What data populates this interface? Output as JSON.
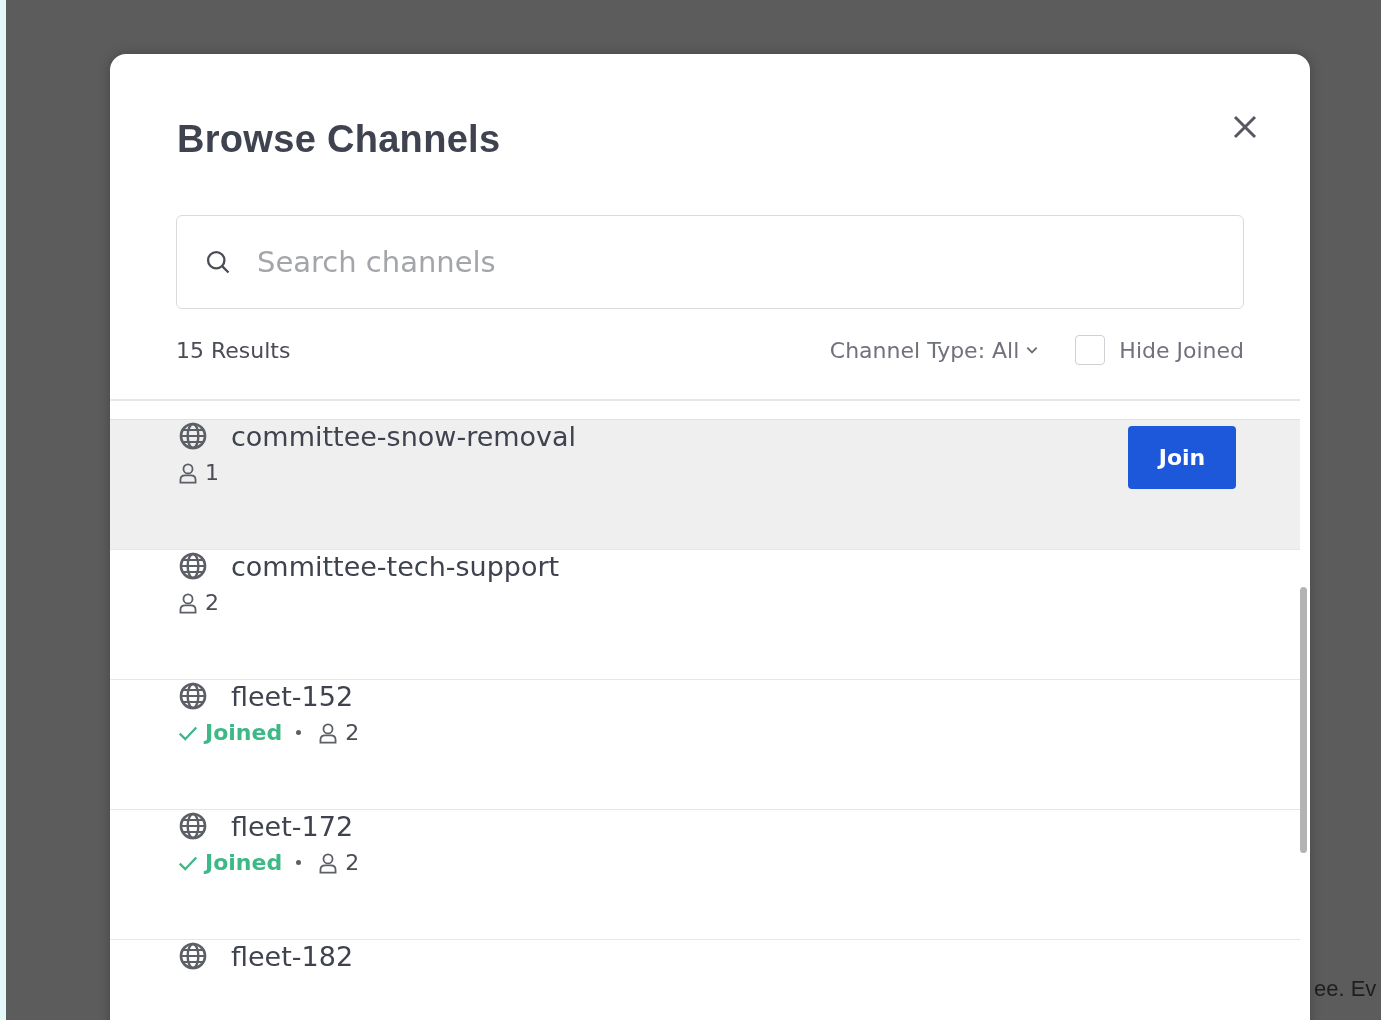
{
  "dialog": {
    "title": "Browse Channels",
    "search": {
      "placeholder": "Search channels"
    },
    "results_count": "15 Results",
    "channel_type_filter": "Channel Type: All",
    "hide_joined": {
      "label": "Hide Joined",
      "checked": false
    },
    "channels": [
      {
        "name": "committee-snow-removal",
        "members": "1",
        "joined": false,
        "hovered": true,
        "join_label": "Join"
      },
      {
        "name": "committee-tech-support",
        "members": "2",
        "joined": false,
        "hovered": false
      },
      {
        "name": "fleet-152",
        "members": "2",
        "joined": true,
        "joined_label": "Joined",
        "hovered": false
      },
      {
        "name": "fleet-172",
        "members": "2",
        "joined": true,
        "joined_label": "Joined",
        "hovered": false
      },
      {
        "name": "fleet-182",
        "hovered": false
      }
    ]
  },
  "background_text": "ee. Ev"
}
